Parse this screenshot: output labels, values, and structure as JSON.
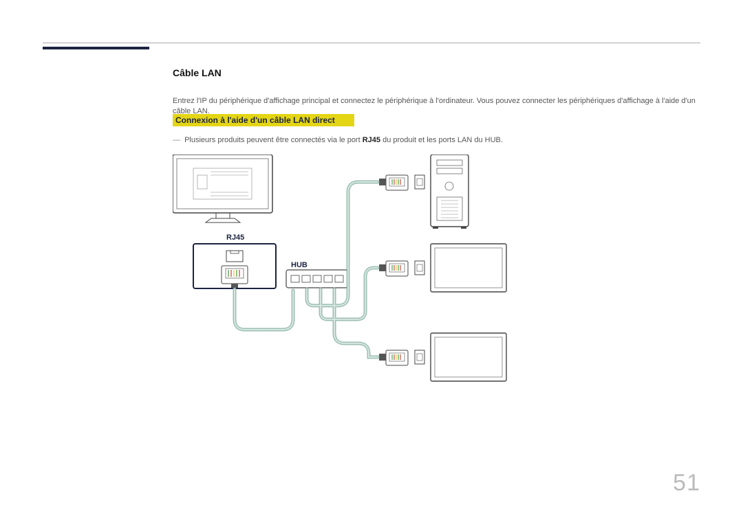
{
  "section_title": "Câble LAN",
  "intro_text": "Entrez l'IP du périphérique d'affichage principal et connectez le périphérique à l'ordinateur. Vous pouvez connecter les périphériques d'affichage à l'aide d'un câble LAN.",
  "yellow_heading": "Connexion à l'aide d'un câble LAN direct",
  "note_text_prefix": "Plusieurs produits peuvent être connectés via le port ",
  "note_bold": "RJ45",
  "note_text_suffix": " du produit et les ports LAN du HUB.",
  "labels": {
    "rj45": "RJ45",
    "hub": "HUB"
  },
  "page_number": "51"
}
